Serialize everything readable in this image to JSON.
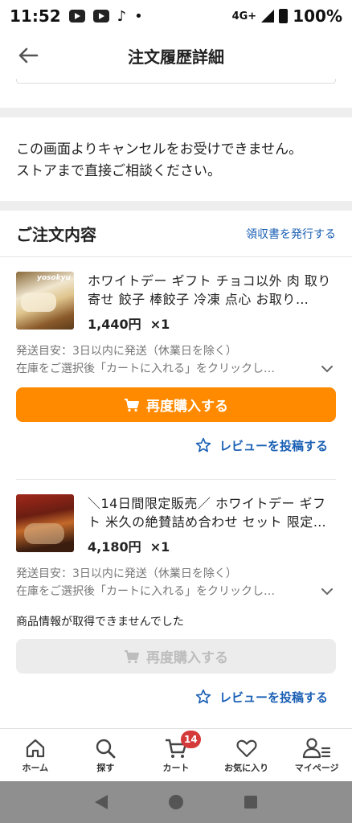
{
  "status_bar": {
    "time": "11:52",
    "network": "4G+",
    "battery": "100%"
  },
  "header": {
    "title": "注文履歴詳細"
  },
  "notice": {
    "line1": "この画面よりキャンセルをお受けできません。",
    "line2": "ストアまで直接ご相談ください。"
  },
  "order_section": {
    "title": "ご注文内容",
    "receipt_link": "領収書を発行する"
  },
  "items": [
    {
      "thumb_logo": "yosokyu",
      "name": "ホワイトデー ギフト チョコ以外 肉 取り寄せ 餃子 棒餃子 冷凍 点心 お取り…",
      "price": "1,440円",
      "qty": "×1",
      "ship_estimate": "発送目安：3日以内に発送（休業日を除く）",
      "ship_note": "在庫をご選択後「カートに入れる」をクリックし…",
      "rebuy_label": "再度購入する",
      "review_label": "レビューを投稿する"
    },
    {
      "name": "＼14日間限定販売／ ホワイトデー ギフト 米久の絶賛詰め合わせ セット 限定…",
      "price": "4,180円",
      "qty": "×1",
      "ship_estimate": "発送目安：3日以内に発送（休業日を除く）",
      "ship_note": "在庫をご選択後「カートに入れる」をクリックし…",
      "error": "商品情報が取得できませんでした",
      "rebuy_label": "再度購入する",
      "review_label": "レビューを投稿する"
    }
  ],
  "bottom_nav": {
    "home": "ホーム",
    "search": "探す",
    "cart": "カート",
    "cart_count": "14",
    "favorites": "お気に入り",
    "mypage": "マイページ"
  },
  "colors": {
    "accent": "#ff8a00",
    "link": "#1a5fb4",
    "badge": "#d43a3a"
  }
}
